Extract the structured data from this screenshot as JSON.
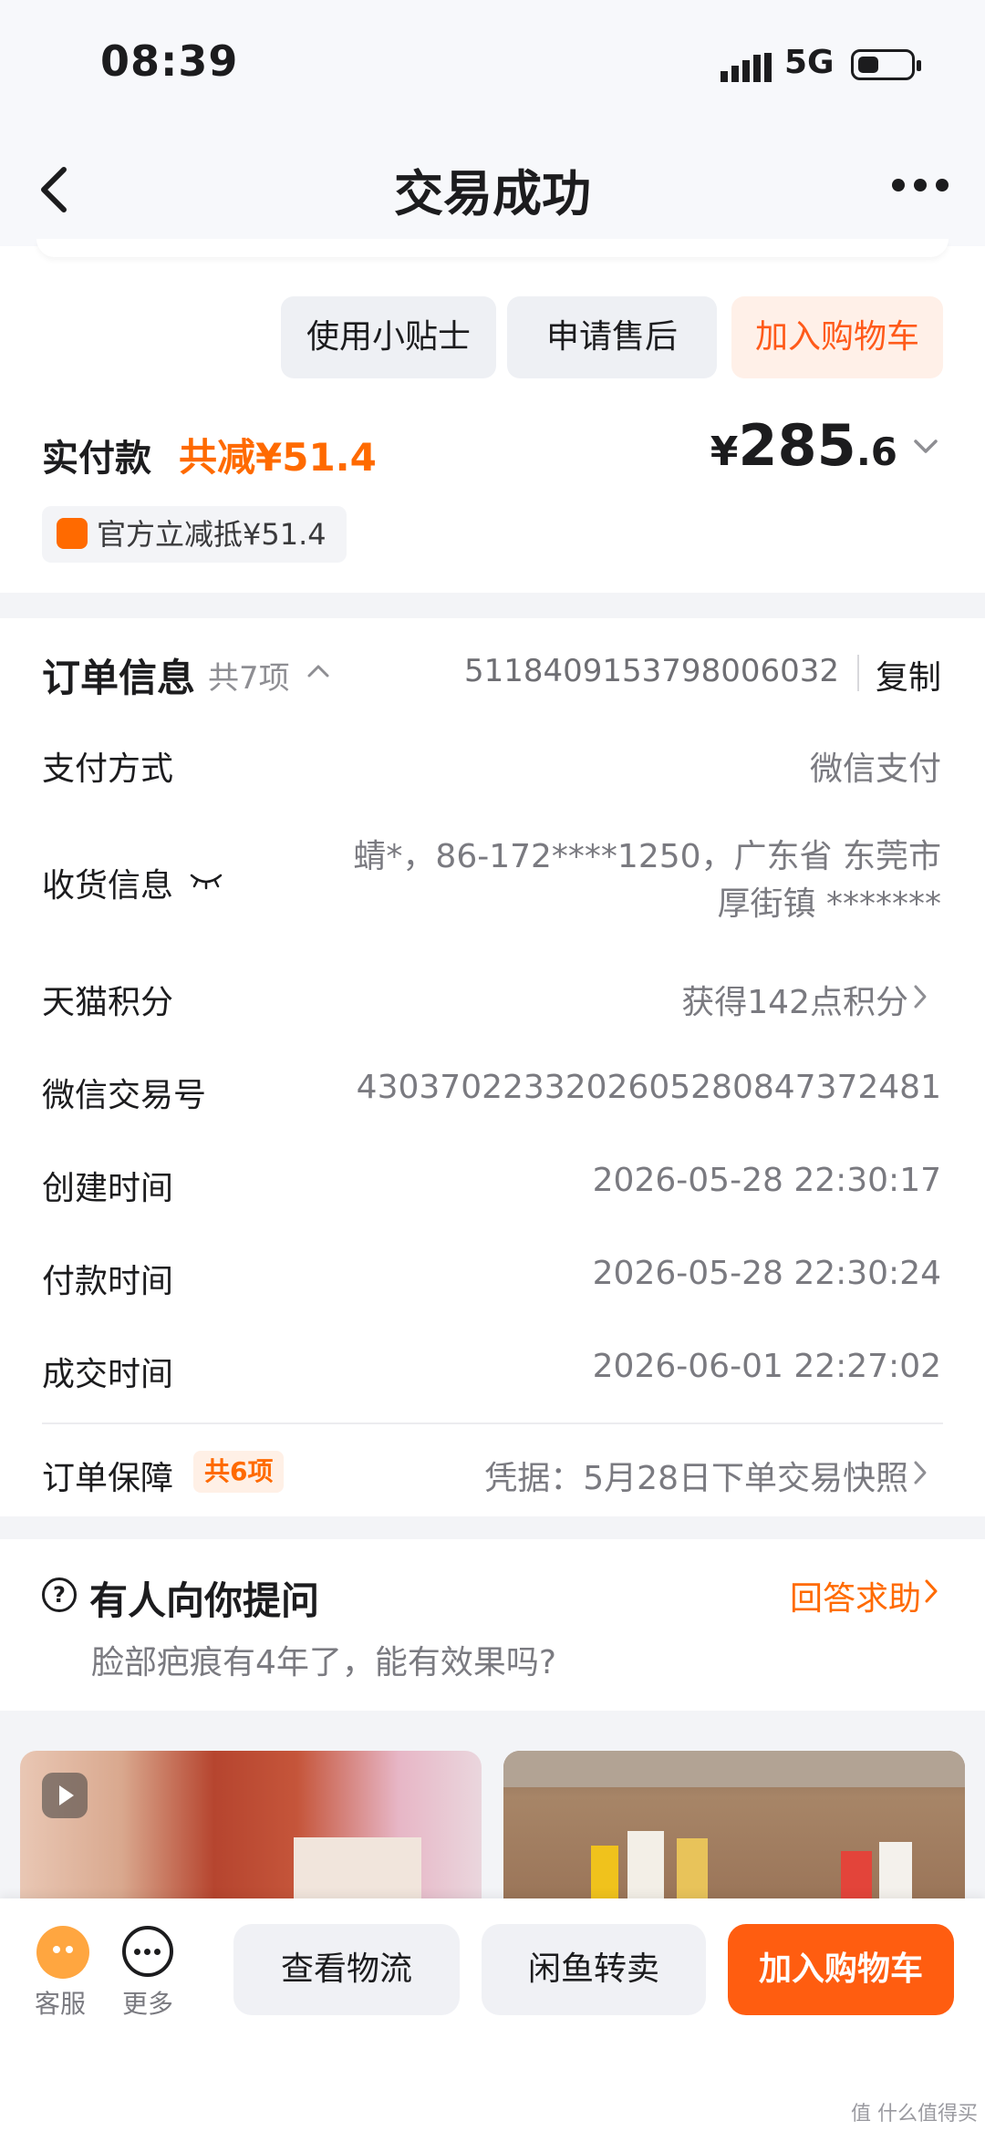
{
  "status_bar": {
    "time": "08:39",
    "network": "5G"
  },
  "nav": {
    "title": "交易成功"
  },
  "actions": {
    "tips": "使用小贴士",
    "after_sale": "申请售后",
    "add_to_cart": "加入购物车"
  },
  "payment": {
    "label": "实付款",
    "discount": "共减¥51.4",
    "currency": "¥",
    "price_int": "285",
    "price_dec": ".6",
    "coupon": "官方立减抵¥51.4"
  },
  "order_info": {
    "title": "订单信息",
    "count": "共7项",
    "order_no": "5118409153798006032",
    "copy": "复制",
    "rows": [
      {
        "label": "支付方式",
        "value": "微信支付"
      },
      {
        "label": "收货信息",
        "value": "蜻*，86-172****1250，广东省 东莞市 厚街镇 *******"
      },
      {
        "label": "天猫积分",
        "value": "获得142点积分"
      },
      {
        "label": "微信交易号",
        "value": "4303702233202605280847372481"
      },
      {
        "label": "创建时间",
        "value": "2026-05-28 22:30:17"
      },
      {
        "label": "付款时间",
        "value": "2026-05-28 22:30:24"
      },
      {
        "label": "成交时间",
        "value": "2026-06-01 22:27:02"
      }
    ],
    "guarantee": {
      "label": "订单保障",
      "badge": "共6项",
      "value": "凭据：5月28日下单交易快照"
    }
  },
  "question": {
    "title": "有人向你提问",
    "help": "回答求助",
    "text": "脸部疤痕有4年了，能有效果吗?"
  },
  "bottom_bar": {
    "service": "客服",
    "more": "更多",
    "logistics": "查看物流",
    "resell": "闲鱼转卖",
    "add_to_cart": "加入购物车"
  },
  "watermark": "值 什么值得买",
  "colors": {
    "accent": "#ff6a00",
    "primary_button": "#ff5d10",
    "text": "#1c1c1e",
    "secondary_text": "#7a7a80"
  }
}
